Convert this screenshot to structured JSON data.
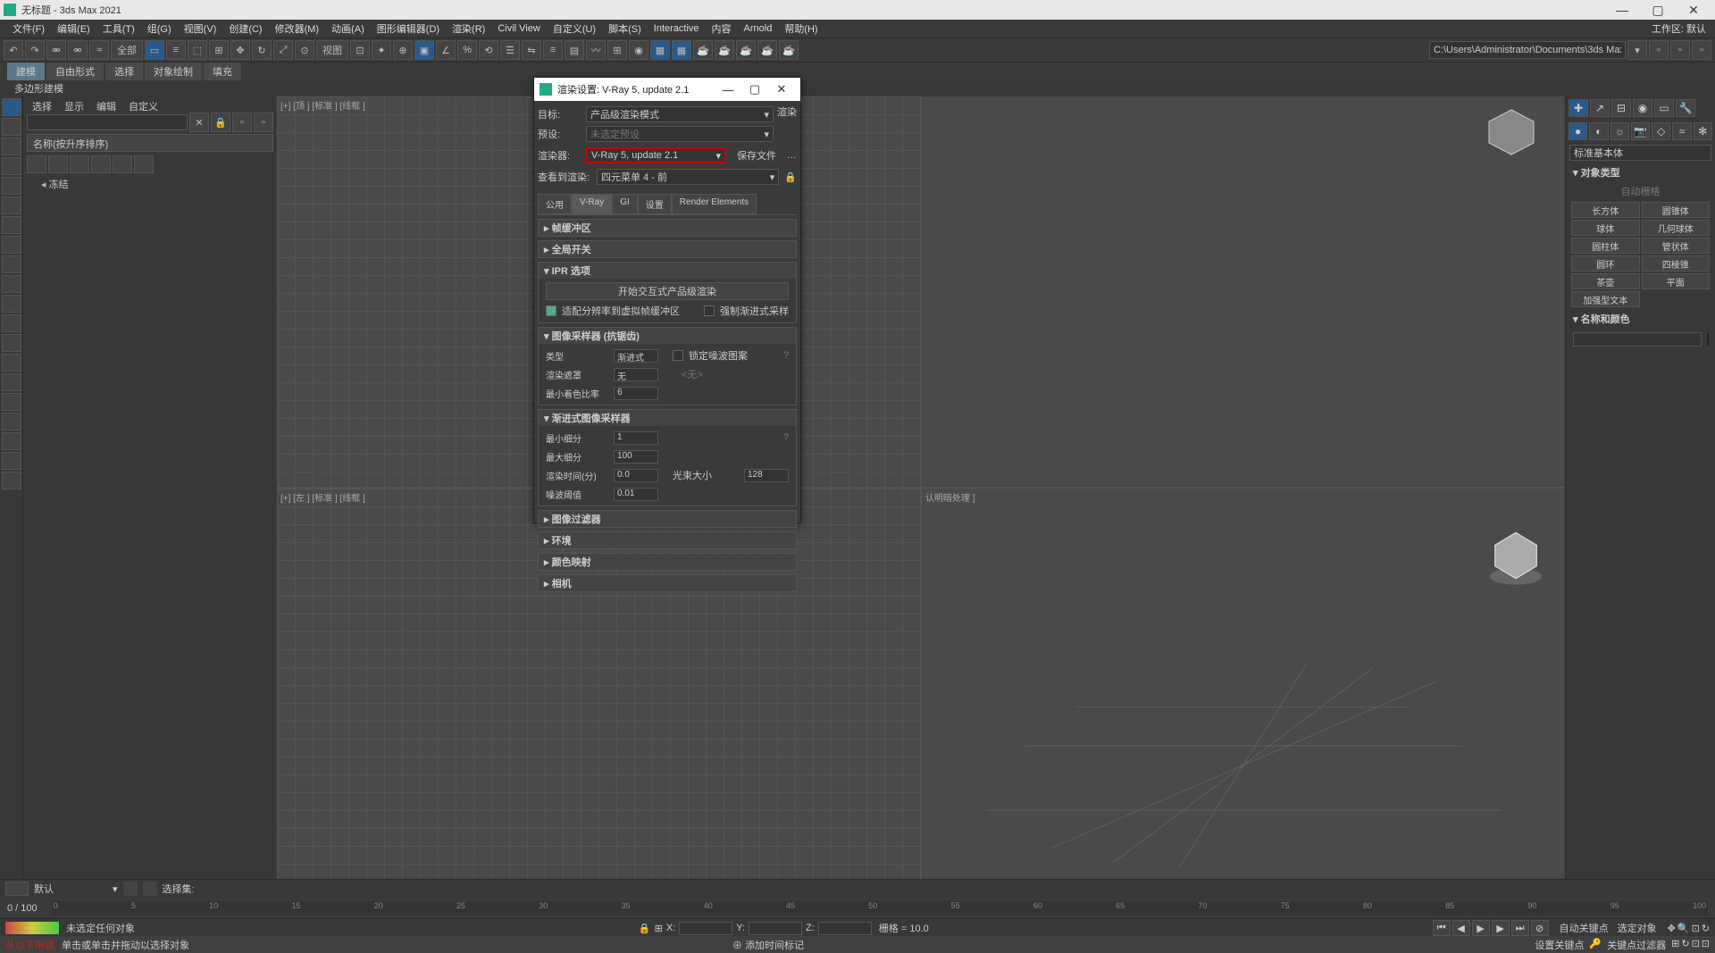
{
  "window": {
    "title": "无标题 - 3ds Max 2021"
  },
  "menu": [
    "文件(F)",
    "编辑(E)",
    "工具(T)",
    "组(G)",
    "视图(V)",
    "创建(C)",
    "修改器(M)",
    "动画(A)",
    "图形编辑器(D)",
    "渲染(R)",
    "Civil View",
    "自定义(U)",
    "脚本(S)",
    "Interactive",
    "内容",
    "Arnold",
    "帮助(H)"
  ],
  "workspace": {
    "label": "工作区: 默认"
  },
  "toolbar": {
    "selector": "全部",
    "viewlabel": "视图",
    "path": "C:\\Users\\Administrator\\Documents\\3ds Max 2021"
  },
  "tabs": {
    "items": [
      "建模",
      "自由形式",
      "选择",
      "对象绘制",
      "填充"
    ],
    "sub": "多边形建模"
  },
  "scenePanel": {
    "menu": [
      "选择",
      "显示",
      "编辑",
      "自定义"
    ],
    "nameSort": "名称(按升序排序)",
    "frozen": "冻结"
  },
  "viewports": {
    "top": "[+] [顶 ] [标准 ] [线框 ]",
    "left": "[+] [左 ] [标准 ] [线框 ]",
    "persp": "认明暗处理 ]"
  },
  "renderDlg": {
    "title": "渲染设置: V-Ray 5, update 2.1",
    "target_lbl": "目标:",
    "target_val": "产品级渲染模式",
    "render_btn": "渲染",
    "preset_lbl": "预设:",
    "preset_val": "未选定预设",
    "renderer_lbl": "渲染器:",
    "renderer_val": "V-Ray 5, update 2.1",
    "save_lbl": "保存文件",
    "viewto_lbl": "查看到渲染:",
    "viewto_val": "四元菜单 4 - 前",
    "tabs": [
      "公用",
      "V-Ray",
      "GI",
      "设置",
      "Render Elements"
    ],
    "rollouts": {
      "framebuf": "▸ 帧缓冲区",
      "global": "▸ 全局开关",
      "ipr": "▾ IPR 选项",
      "ipr_btn": "开始交互式产品级渲染",
      "ipr_chk1": "适配分辨率到虚拟帧缓冲区",
      "ipr_chk2": "强制渐进式采样",
      "sampler": "▾ 图像采样器 (抗锯齿)",
      "type_lbl": "类型",
      "type_val": "渐进式",
      "lock_lbl": "锁定噪波图案",
      "mask_lbl": "渲染遮罩",
      "mask_val": "无",
      "mask_none": "<无>",
      "minshade_lbl": "最小着色比率",
      "minshade_val": "6",
      "progressive": "▾ 渐进式图像采样器",
      "minsub_lbl": "最小细分",
      "minsub_val": "1",
      "maxsub_lbl": "最大细分",
      "maxsub_val": "100",
      "time_lbl": "渲染时间(分)",
      "time_val": "0.0",
      "bundle_lbl": "光束大小",
      "bundle_val": "128",
      "noise_lbl": "噪波阈值",
      "noise_val": "0.01",
      "filter": "▸ 图像过滤器",
      "env": "▸ 环境",
      "colormap": "▸ 颜色映射",
      "camera": "▸ 相机"
    }
  },
  "cmdPanel": {
    "dropdown": "标准基本体",
    "section1": "▾ 对象类型",
    "autogrid": "自动栅格",
    "prims": [
      "长方体",
      "圆锥体",
      "球体",
      "几何球体",
      "圆柱体",
      "管状体",
      "圆环",
      "四棱锥",
      "茶壶",
      "平面",
      "加强型文本"
    ],
    "section2": "▾ 名称和颜色"
  },
  "bottom": {
    "frames": "0 / 100",
    "default": "默认",
    "selset": "选择集:",
    "ticks": [
      "0",
      "5",
      "10",
      "15",
      "20",
      "25",
      "30",
      "35",
      "40",
      "45",
      "50",
      "55",
      "60",
      "65",
      "70",
      "75",
      "80",
      "85",
      "90",
      "95",
      "100"
    ],
    "status1": "未选定任何对象",
    "x": "X:",
    "y": "Y:",
    "z": "Z:",
    "grid": "栅格 = 10.0",
    "addtime": "添加时间标记",
    "autokey": "自动关键点",
    "selobj": "选定对象",
    "setkey": "设置关键点",
    "keyfilter": "关键点过滤器",
    "apply": "从以下申请",
    "prompt": "单击或单击并拖动以选择对象"
  }
}
